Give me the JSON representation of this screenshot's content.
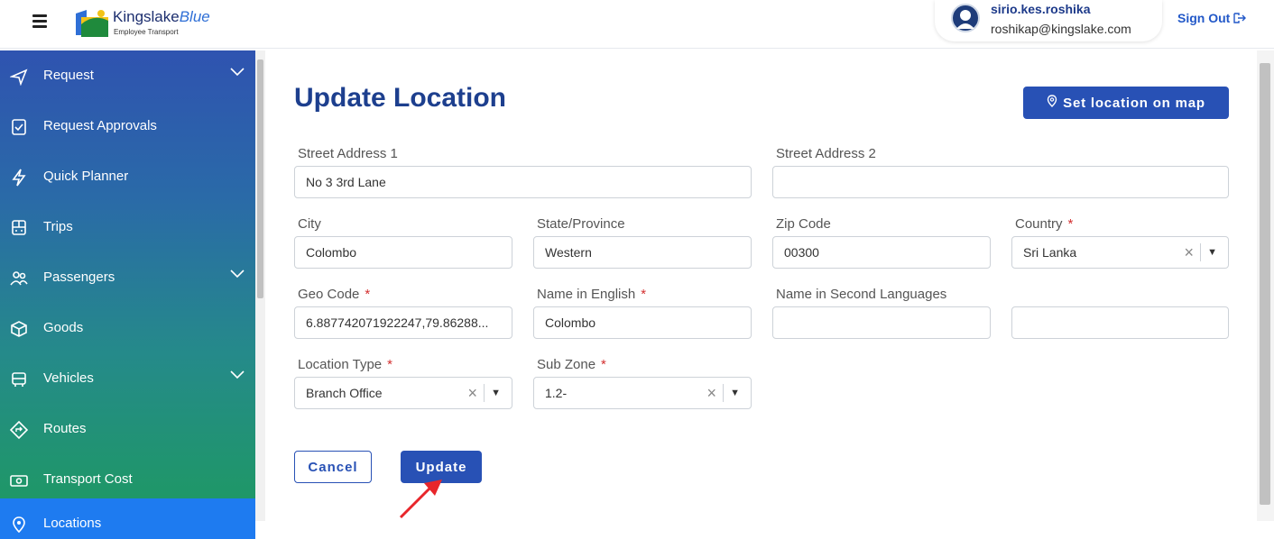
{
  "header": {
    "logo_text": "Kingslake",
    "logo_text_accent": "Blue",
    "logo_sub": "Employee Transport",
    "user_name": "sirio.kes.roshika",
    "user_email": "roshikap@kingslake.com",
    "sign_out": "Sign Out"
  },
  "sidebar": {
    "items": [
      {
        "label": "Request",
        "icon": "send-icon",
        "expandable": true
      },
      {
        "label": "Request Approvals",
        "icon": "approval-icon",
        "expandable": false
      },
      {
        "label": "Quick Planner",
        "icon": "lightning-icon",
        "expandable": false
      },
      {
        "label": "Trips",
        "icon": "bus-front-icon",
        "expandable": false
      },
      {
        "label": "Passengers",
        "icon": "people-icon",
        "expandable": true
      },
      {
        "label": "Goods",
        "icon": "box-icon",
        "expandable": false
      },
      {
        "label": "Vehicles",
        "icon": "vehicle-icon",
        "expandable": true
      },
      {
        "label": "Routes",
        "icon": "route-icon",
        "expandable": false
      },
      {
        "label": "Transport Cost",
        "icon": "cash-icon",
        "expandable": false
      },
      {
        "label": "Locations",
        "icon": "location-pin-icon",
        "expandable": false,
        "active": true
      }
    ]
  },
  "main": {
    "title": "Update Location",
    "set_location_button": "Set location on map",
    "fields": {
      "street1": {
        "label": "Street Address 1",
        "value": "No 3 3rd Lane"
      },
      "street2": {
        "label": "Street Address 2",
        "value": ""
      },
      "city": {
        "label": "City",
        "value": "Colombo"
      },
      "state": {
        "label": "State/Province",
        "value": "Western"
      },
      "zip": {
        "label": "Zip Code",
        "value": "00300"
      },
      "country": {
        "label": "Country",
        "value": "Sri Lanka",
        "required": "*"
      },
      "geocode": {
        "label": "Geo Code",
        "value": "6.887742071922247,79.86288...",
        "required": "*"
      },
      "name_en": {
        "label": "Name in English",
        "value": "Colombo",
        "required": "*"
      },
      "name_second": {
        "label": "Name in Second Languages",
        "value": ""
      },
      "name_second_2": {
        "value": ""
      },
      "location_type": {
        "label": "Location Type",
        "value": "Branch Office",
        "required": "*"
      },
      "sub_zone": {
        "label": "Sub Zone",
        "value": "1.2-",
        "required": "*"
      }
    },
    "cancel_button": "Cancel",
    "update_button": "Update"
  },
  "colors": {
    "primary": "#2851b5",
    "title": "#1d3f8e",
    "required": "#d32f2f",
    "annotation_arrow": "#e8262b"
  }
}
